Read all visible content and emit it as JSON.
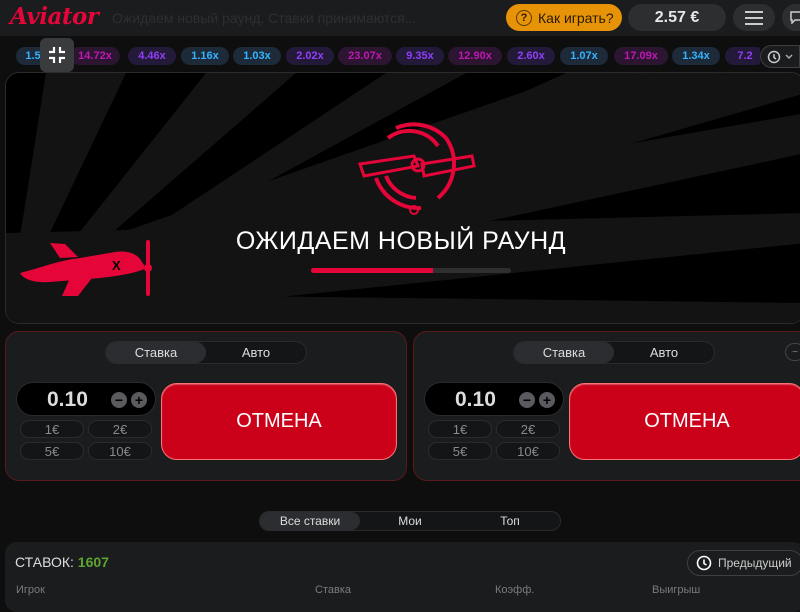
{
  "header": {
    "logo": "Aviator",
    "ticker": "Ожидаем новый раунд. Ставки принимаются...",
    "how_to_play": "Как играть?",
    "balance": "2.57 €"
  },
  "history": {
    "multipliers": [
      {
        "value": "1.5",
        "tone": "blue"
      },
      {
        "value": "14.72x",
        "tone": "purple"
      },
      {
        "value": "4.46x",
        "tone": "purple2"
      },
      {
        "value": "1.16x",
        "tone": "blue"
      },
      {
        "value": "1.03x",
        "tone": "blue"
      },
      {
        "value": "2.02x",
        "tone": "purple2"
      },
      {
        "value": "23.07x",
        "tone": "purple"
      },
      {
        "value": "9.35x",
        "tone": "purple2"
      },
      {
        "value": "12.90x",
        "tone": "purple"
      },
      {
        "value": "2.60x",
        "tone": "purple2"
      },
      {
        "value": "1.07x",
        "tone": "blue"
      },
      {
        "value": "17.09x",
        "tone": "purple"
      },
      {
        "value": "1.34x",
        "tone": "blue"
      },
      {
        "value": "7.2",
        "tone": "purple2"
      }
    ]
  },
  "game": {
    "waiting_title": "ОЖИДАЕМ НОВЫЙ РАУНД",
    "progress": 0.61
  },
  "panels": [
    {
      "tabs": {
        "bet": "Ставка",
        "auto": "Авто"
      },
      "stake": "0.10",
      "quick": [
        "1€",
        "2€",
        "5€",
        "10€"
      ],
      "cancel_label": "ОТМЕНА"
    },
    {
      "tabs": {
        "bet": "Ставка",
        "auto": "Авто"
      },
      "stake": "0.10",
      "quick": [
        "1€",
        "2€",
        "5€",
        "10€"
      ],
      "cancel_label": "ОТМЕНА"
    }
  ],
  "bets_filter": {
    "all": "Все ставки",
    "mine": "Мои",
    "top": "Топ"
  },
  "bets": {
    "label": "СТАВОК:",
    "count": "1607",
    "previous": "Предыдущий",
    "columns": {
      "player": "Игрок",
      "stake": "Ставка",
      "coef": "Коэфф.",
      "win": "Выигрыш"
    }
  },
  "colors": {
    "accent": "#e50539",
    "cancel": "#cb011a",
    "gold": "#e69308",
    "count_green": "#5da531"
  }
}
